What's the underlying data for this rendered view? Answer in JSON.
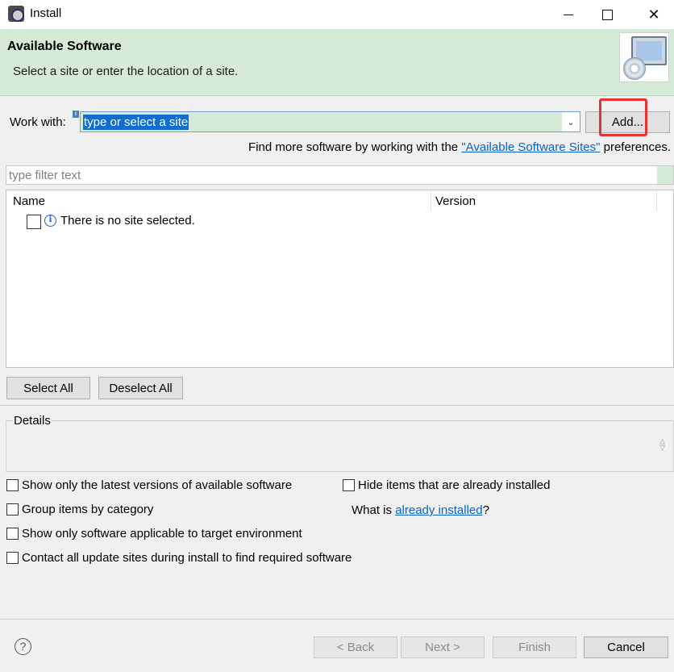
{
  "window": {
    "title": "Install",
    "icon": "eclipse-app-icon"
  },
  "banner": {
    "title": "Available Software",
    "description": "Select a site or enter the location of a site.",
    "image": "software-monitor-cd-icon"
  },
  "work_with": {
    "label": "Work with:",
    "value": "type or select a site",
    "add_button": "Add...",
    "find_more_prefix": "Find more software by working with the ",
    "find_more_link": "\"Available Software Sites\"",
    "find_more_suffix": " preferences."
  },
  "filter": {
    "placeholder": "type filter text"
  },
  "table": {
    "columns": [
      "Name",
      "Version"
    ],
    "rows": [
      {
        "checked": false,
        "icon": "info-icon",
        "name": "There is no site selected.",
        "version": ""
      }
    ]
  },
  "buttons": {
    "select_all": "Select All",
    "deselect_all": "Deselect All"
  },
  "details": {
    "label": "Details"
  },
  "options": [
    {
      "label": "Show only the latest versions of available software",
      "checked": false
    },
    {
      "label": "Hide items that are already installed",
      "checked": false
    },
    {
      "label": "Group items by category",
      "checked": false
    },
    {
      "label": "Show only software applicable to target environment",
      "checked": false
    },
    {
      "label": "Contact all update sites during install to find required software",
      "checked": false
    }
  ],
  "already_installed": {
    "prefix": "What is ",
    "link": "already installed",
    "suffix": "?"
  },
  "footer": {
    "back": "< Back",
    "next": "Next >",
    "finish": "Finish",
    "cancel": "Cancel"
  },
  "colors": {
    "banner_bg": "#d5ebd8",
    "selection": "#0f6fd0",
    "link": "#0b63c4",
    "highlight": "#e53333"
  }
}
